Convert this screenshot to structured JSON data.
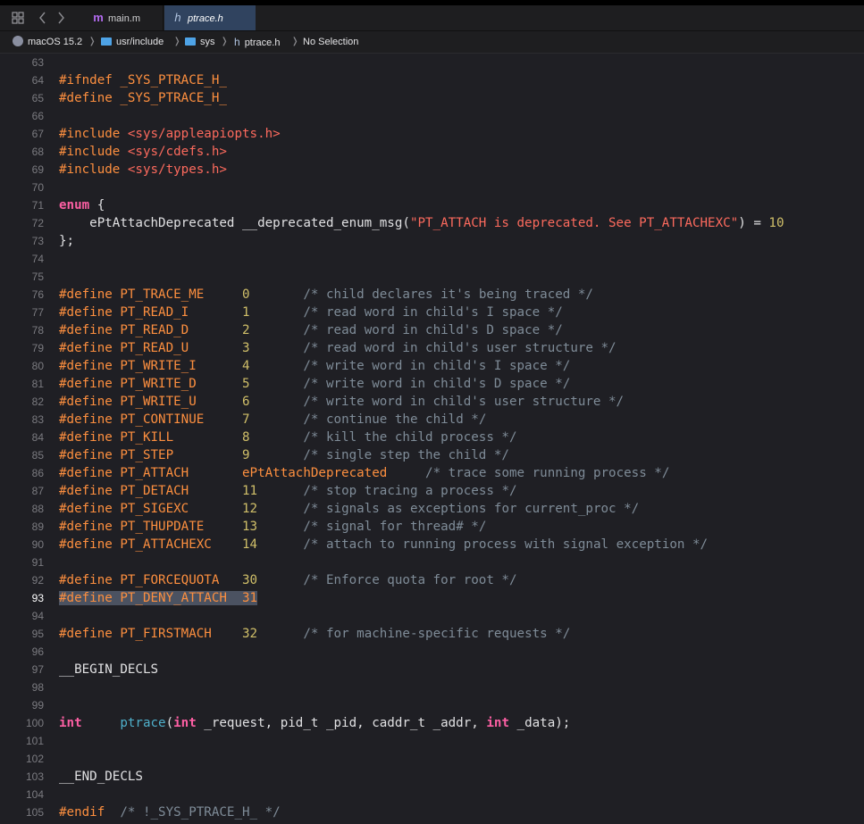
{
  "tabbar": {
    "grid_icon": "grid-icon",
    "back_icon": "chevron-left-icon",
    "forward_icon": "chevron-right-icon",
    "tabs": [
      {
        "icon": "m",
        "label": "main.m"
      },
      {
        "icon": "h",
        "label": "ptrace.h"
      }
    ]
  },
  "jumpbar": {
    "items": [
      {
        "icon": "macos-icon",
        "label": "macOS 15.2"
      },
      {
        "icon": "folder-icon",
        "label": "usr/include"
      },
      {
        "icon": "folder-icon",
        "label": "sys"
      },
      {
        "icon": "header-file-icon",
        "label": "ptrace.h"
      },
      {
        "icon": "",
        "label": "No Selection"
      }
    ],
    "separator": "❭"
  },
  "editor": {
    "current_line": 93,
    "colors": {
      "keyword": "#fc5fa3",
      "preprocessor": "#fd8f3f",
      "string": "#fc6a5d",
      "number": "#d0bf69",
      "comment": "#7f8c98",
      "selection": "#4b5261"
    },
    "lines": [
      {
        "n": "63",
        "t": ""
      },
      {
        "n": "64",
        "t": "#ifndef _SYS_PTRACE_H_"
      },
      {
        "n": "65",
        "t": "#define _SYS_PTRACE_H_"
      },
      {
        "n": "66",
        "t": ""
      },
      {
        "n": "67",
        "t": "#include <sys/appleapiopts.h>"
      },
      {
        "n": "68",
        "t": "#include <sys/cdefs.h>"
      },
      {
        "n": "69",
        "t": "#include <sys/types.h>"
      },
      {
        "n": "70",
        "t": ""
      },
      {
        "n": "71",
        "t": "enum {"
      },
      {
        "n": "72",
        "t": "    ePtAttachDeprecated __deprecated_enum_msg(\"PT_ATTACH is deprecated. See PT_ATTACHEXC\") = 10"
      },
      {
        "n": "73",
        "t": "};"
      },
      {
        "n": "74",
        "t": ""
      },
      {
        "n": "75",
        "t": ""
      },
      {
        "n": "76",
        "t": "#define PT_TRACE_ME     0       /* child declares it's being traced */"
      },
      {
        "n": "77",
        "t": "#define PT_READ_I       1       /* read word in child's I space */"
      },
      {
        "n": "78",
        "t": "#define PT_READ_D       2       /* read word in child's D space */"
      },
      {
        "n": "79",
        "t": "#define PT_READ_U       3       /* read word in child's user structure */"
      },
      {
        "n": "80",
        "t": "#define PT_WRITE_I      4       /* write word in child's I space */"
      },
      {
        "n": "81",
        "t": "#define PT_WRITE_D      5       /* write word in child's D space */"
      },
      {
        "n": "82",
        "t": "#define PT_WRITE_U      6       /* write word in child's user structure */"
      },
      {
        "n": "83",
        "t": "#define PT_CONTINUE     7       /* continue the child */"
      },
      {
        "n": "84",
        "t": "#define PT_KILL         8       /* kill the child process */"
      },
      {
        "n": "85",
        "t": "#define PT_STEP         9       /* single step the child */"
      },
      {
        "n": "86",
        "t": "#define PT_ATTACH       ePtAttachDeprecated     /* trace some running process */"
      },
      {
        "n": "87",
        "t": "#define PT_DETACH       11      /* stop tracing a process */"
      },
      {
        "n": "88",
        "t": "#define PT_SIGEXC       12      /* signals as exceptions for current_proc */"
      },
      {
        "n": "89",
        "t": "#define PT_THUPDATE     13      /* signal for thread# */"
      },
      {
        "n": "90",
        "t": "#define PT_ATTACHEXC    14      /* attach to running process with signal exception */"
      },
      {
        "n": "91",
        "t": ""
      },
      {
        "n": "92",
        "t": "#define PT_FORCEQUOTA   30      /* Enforce quota for root */"
      },
      {
        "n": "93",
        "t": "#define PT_DENY_ATTACH  31"
      },
      {
        "n": "94",
        "t": ""
      },
      {
        "n": "95",
        "t": "#define PT_FIRSTMACH    32      /* for machine-specific requests */"
      },
      {
        "n": "96",
        "t": ""
      },
      {
        "n": "97",
        "t": "__BEGIN_DECLS"
      },
      {
        "n": "98",
        "t": ""
      },
      {
        "n": "99",
        "t": ""
      },
      {
        "n": "100",
        "t": "int     ptrace(int _request, pid_t _pid, caddr_t _addr, int _data);"
      },
      {
        "n": "101",
        "t": ""
      },
      {
        "n": "102",
        "t": ""
      },
      {
        "n": "103",
        "t": "__END_DECLS"
      },
      {
        "n": "104",
        "t": ""
      },
      {
        "n": "105",
        "t": "#endif  /* !_SYS_PTRACE_H_ */"
      }
    ]
  }
}
